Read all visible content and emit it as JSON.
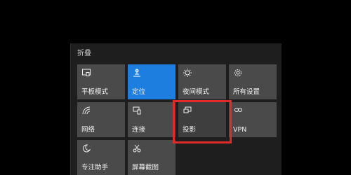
{
  "action_center": {
    "collapse_label": "折叠",
    "tiles": [
      {
        "label": "平板模式",
        "icon": "tablet-mode-icon",
        "state": "off"
      },
      {
        "label": "定位",
        "icon": "location-icon",
        "state": "on"
      },
      {
        "label": "夜间模式",
        "icon": "night-light-icon",
        "state": "off"
      },
      {
        "label": "所有设置",
        "icon": "gear-icon",
        "state": "off"
      },
      {
        "label": "网络",
        "icon": "network-icon",
        "state": "off"
      },
      {
        "label": "连接",
        "icon": "connect-icon",
        "state": "off"
      },
      {
        "label": "投影",
        "icon": "project-icon",
        "state": "off",
        "highlighted": true
      },
      {
        "label": "VPN",
        "icon": "vpn-icon",
        "state": "off"
      },
      {
        "label": "专注助手",
        "icon": "focus-assist-icon",
        "state": "off"
      },
      {
        "label": "屏幕截图",
        "icon": "screen-snip-icon",
        "state": "off"
      }
    ]
  },
  "colors": {
    "tile_bg": "#4a4a4a",
    "tile_active_bg": "#1d7ee0",
    "highlight_border": "#e02b2b"
  }
}
